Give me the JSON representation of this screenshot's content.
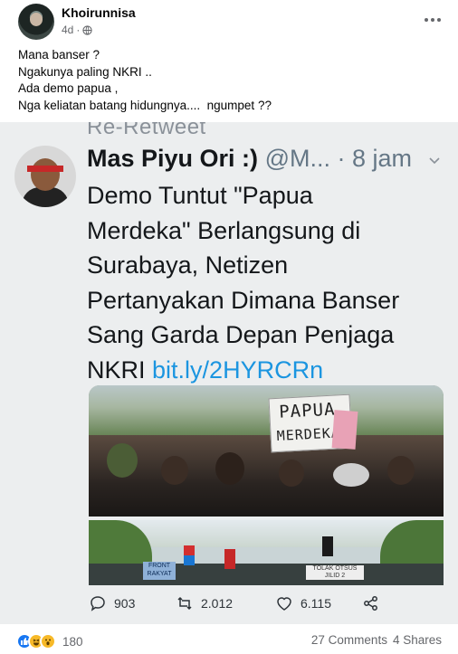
{
  "post": {
    "author": "Khoirunnisa",
    "time": "4d",
    "separator": "·",
    "lines": [
      "Mana banser ?",
      "Ngakunya paling NKRI ..",
      "Ada demo papua ,",
      "Nga keliatan batang hidungnya....  ngumpet ??"
    ]
  },
  "tweet": {
    "retweet_bar": "Re-Retweet",
    "name": "Mas Piyu Ori :)",
    "handle": "@M...",
    "time": "· 8 jam",
    "body_lines": [
      "Demo Tuntut \"Papua",
      "Merdeka\" Berlangsung di",
      "Surabaya, Netizen",
      "Pertanyakan Dimana Banser",
      "Sang Garda Depan Penjaga"
    ],
    "body_last_prefix": "NKRI",
    "link": "bit.ly/2HYRCRn",
    "sign_line1": "PAPUA",
    "sign_line2": "MERDEKA",
    "small_banner": "FRONT RAKYAT",
    "small_banner2": "TOLAK OTSUS JILID 2",
    "actions": {
      "replies": "903",
      "retweets": "2.012",
      "likes": "6.115"
    }
  },
  "footer": {
    "reaction_count": "180",
    "comments": "27 Comments",
    "shares": "4 Shares"
  },
  "colors": {
    "link": "#1b95e0",
    "like_blue": "#1877f2",
    "muted": "#65676b"
  }
}
